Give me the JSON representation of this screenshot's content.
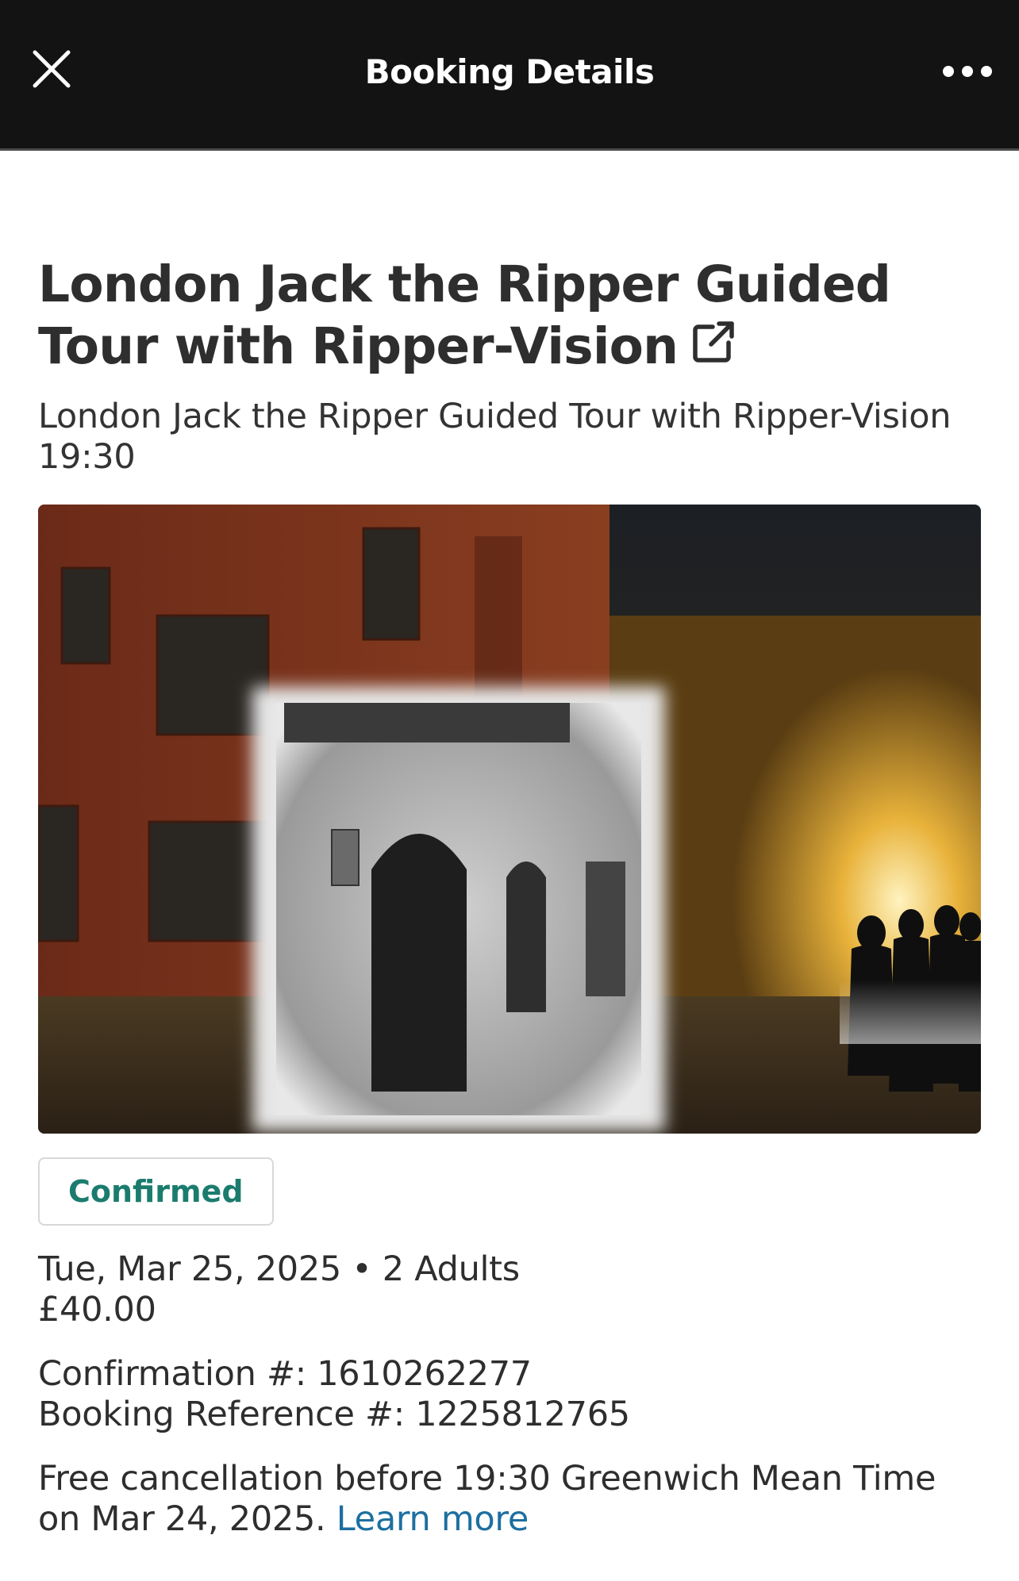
{
  "header": {
    "title": "Booking Details",
    "close_icon": "close-icon",
    "more_icon": "more-horizontal-icon"
  },
  "booking": {
    "title": "London Jack the Ripper Guided Tour with Ripper-Vision",
    "external_link_icon": "external-link-icon",
    "subtitle": "London Jack the Ripper Guided Tour with Ripper-Vision 19:30",
    "status": "Confirmed",
    "date": "Tue, Mar 25, 2025",
    "separator": "•",
    "guests": "2 Adults",
    "price": "£40.00",
    "confirmation": "Confirmation #: 1610262277",
    "reference": "Booking Reference #: 1225812765",
    "cancellation": "Free cancellation before 19:30 Greenwich Mean Time on Mar 24, 2025.",
    "learn_more": "Learn more"
  },
  "colors": {
    "header_bg": "#131313",
    "status_green": "#1b7c6e",
    "link_blue": "#1d6fa0"
  }
}
